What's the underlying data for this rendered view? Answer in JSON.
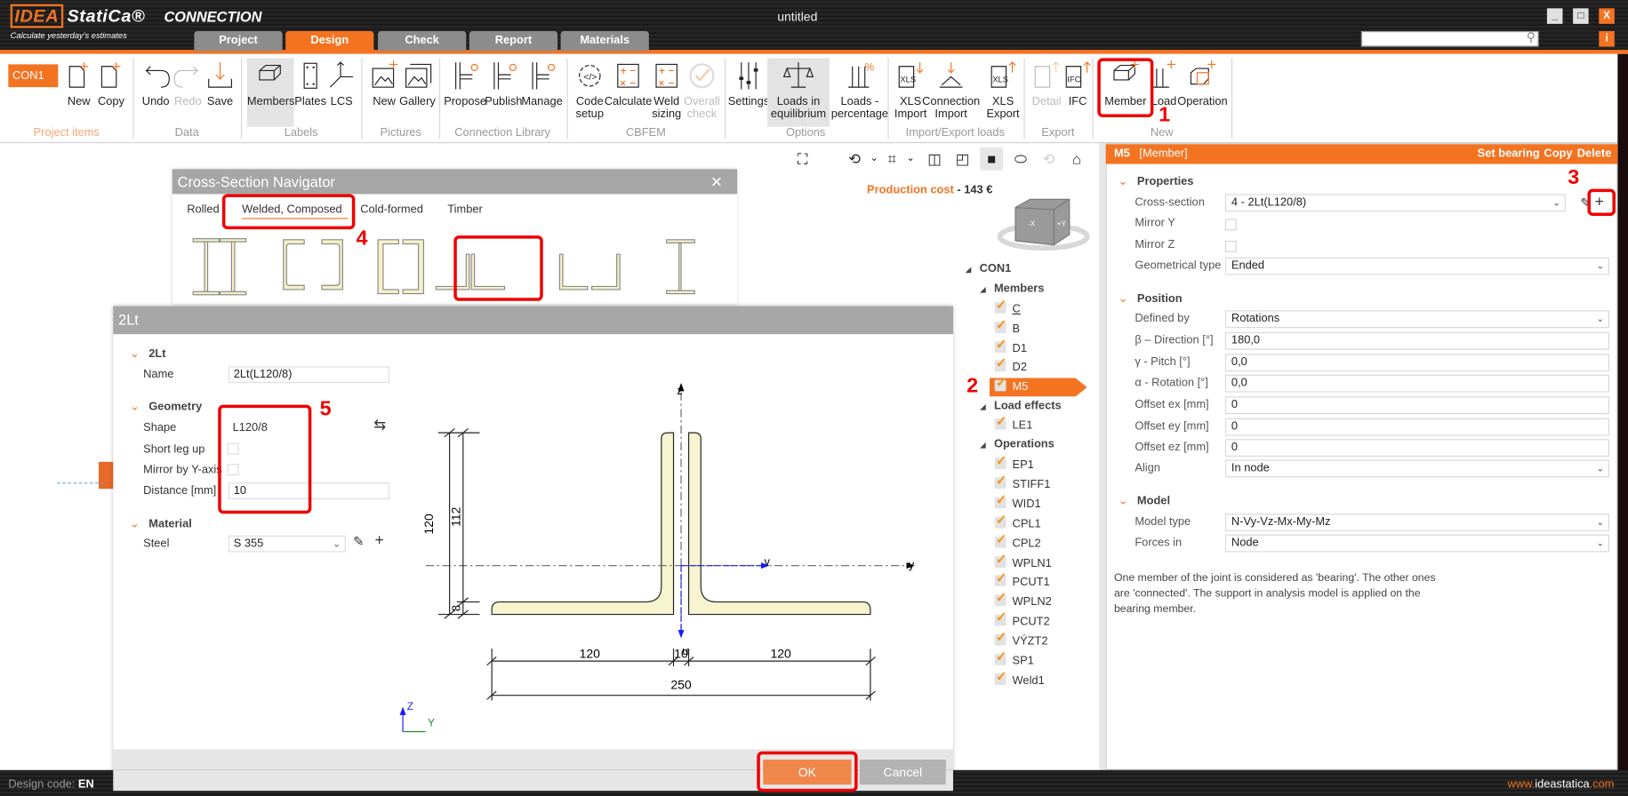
{
  "app": {
    "logo_mark": "IDEA",
    "logo_text": "StatiCa®",
    "product": "CONNECTION",
    "tagline": "Calculate yesterday's estimates",
    "title": "untitled",
    "window_buttons": [
      "_",
      "□",
      "X"
    ],
    "info": "i",
    "search_placeholder": ""
  },
  "tabs": [
    {
      "label": "Project",
      "active": false
    },
    {
      "label": "Design",
      "active": true
    },
    {
      "label": "Check",
      "active": false
    },
    {
      "label": "Report",
      "active": false
    },
    {
      "label": "Materials",
      "active": false
    }
  ],
  "ribbon": {
    "project_selector": "CON1",
    "buttons": [
      {
        "id": "new",
        "label": "New",
        "icon": "doc-plus-icon",
        "group": "Project items"
      },
      {
        "id": "copy",
        "label": "Copy",
        "icon": "doc-copy-icon",
        "group": "Project items"
      },
      {
        "id": "undo",
        "label": "Undo",
        "icon": "undo-icon",
        "group": "Data"
      },
      {
        "id": "redo",
        "label": "Redo",
        "icon": "redo-icon",
        "group": "Data",
        "disabled": true
      },
      {
        "id": "save",
        "label": "Save",
        "icon": "save-icon",
        "group": "Data"
      },
      {
        "id": "members",
        "label": "Members",
        "icon": "beam-icon",
        "group": "Labels",
        "active": true
      },
      {
        "id": "plates",
        "label": "Plates",
        "icon": "plate-icon",
        "group": "Labels"
      },
      {
        "id": "lcs",
        "label": "LCS",
        "icon": "axes-icon",
        "group": "Labels"
      },
      {
        "id": "picture-new",
        "label": "New",
        "icon": "picture-plus-icon",
        "group": "Pictures"
      },
      {
        "id": "gallery",
        "label": "Gallery",
        "icon": "gallery-icon",
        "group": "Pictures"
      },
      {
        "id": "propose",
        "label": "Propose",
        "icon": "library-search-icon",
        "group": "Connection Library"
      },
      {
        "id": "publish",
        "label": "Publish",
        "icon": "library-upload-icon",
        "group": "Connection Library"
      },
      {
        "id": "manage",
        "label": "Manage",
        "icon": "library-edit-icon",
        "group": "Connection Library"
      },
      {
        "id": "code-setup",
        "label": "Code\nsetup",
        "icon": "gear-code-icon",
        "group": "CBFEM"
      },
      {
        "id": "calculate",
        "label": "Calculate",
        "icon": "calculator-icon",
        "group": "CBFEM"
      },
      {
        "id": "weld-sizing",
        "label": "Weld\nsizing",
        "icon": "weld-calc-icon",
        "group": "CBFEM"
      },
      {
        "id": "overall-check",
        "label": "Overall\ncheck",
        "icon": "check-circle-icon",
        "group": "CBFEM",
        "disabled": true
      },
      {
        "id": "settings",
        "label": "Settings",
        "icon": "sliders-icon",
        "group": "Options"
      },
      {
        "id": "loads-equilibrium",
        "label": "Loads in\nequilibrium",
        "icon": "balance-icon",
        "group": "Options",
        "active": true
      },
      {
        "id": "loads-percentage",
        "label": "Loads -\npercentage",
        "icon": "loads-percent-icon",
        "group": "Options"
      },
      {
        "id": "xls-import",
        "label": "XLS\nImport",
        "icon": "xls-import-icon",
        "group": "Import/Export loads"
      },
      {
        "id": "connection-import",
        "label": "Connection\nImport",
        "icon": "connection-import-icon",
        "group": "Import/Export loads"
      },
      {
        "id": "xls-export",
        "label": "XLS\nExport",
        "icon": "xls-export-icon",
        "group": "Import/Export loads"
      },
      {
        "id": "detail",
        "label": "Detail",
        "icon": "beta-detail-icon",
        "group": "Export",
        "disabled": true
      },
      {
        "id": "ifc",
        "label": "IFC",
        "icon": "ifc-export-icon",
        "group": "Export"
      },
      {
        "id": "member",
        "label": "Member",
        "icon": "member-add-icon",
        "group": "New"
      },
      {
        "id": "load",
        "label": "Load",
        "icon": "load-add-icon",
        "group": "New"
      },
      {
        "id": "operation",
        "label": "Operation",
        "icon": "operation-add-icon",
        "group": "New"
      }
    ],
    "groups": [
      "Project items",
      "Data",
      "Labels",
      "Pictures",
      "Connection Library",
      "CBFEM",
      "Options",
      "Import/Export loads",
      "Export",
      "New"
    ]
  },
  "viewport": {
    "toolbar_icons": [
      "fit-view-icon",
      "rotate-icon",
      "chevron-down-icon",
      "crop-icon",
      "chevron-down-icon",
      "wireframe-icon",
      "transparent-icon",
      "solid-icon",
      "render-icon",
      "mirror-icon",
      "home-icon"
    ],
    "production_cost_label": "Production cost",
    "production_cost_sep": "-",
    "production_cost_value": "143 €",
    "navcube_labels": [
      "-X",
      "+Y"
    ]
  },
  "tree": {
    "root": "CON1",
    "members_label": "Members",
    "members": [
      "C",
      "B",
      "D1",
      "D2",
      "M5"
    ],
    "selected_member": "M5",
    "load_effects_label": "Load effects",
    "load_effects": [
      "LE1"
    ],
    "operations_label": "Operations",
    "operations": [
      "EP1",
      "STIFF1",
      "WID1",
      "CPL1",
      "CPL2",
      "WPLN1",
      "PCUT1",
      "WPLN2",
      "PCUT2",
      "VÝZT2",
      "SP1",
      "Weld1"
    ]
  },
  "properties_panel": {
    "header_name": "M5",
    "header_type": "[Member]",
    "actions": [
      "Set bearing",
      "Copy",
      "Delete"
    ],
    "sections": [
      {
        "title": "Properties",
        "rows": [
          {
            "label": "Cross-section",
            "type": "select",
            "value": "4 - 2Lt(L120/8)",
            "short": true
          },
          {
            "label": "Mirror Y",
            "type": "checkbox",
            "checked": false
          },
          {
            "label": "Mirror Z",
            "type": "checkbox",
            "checked": false
          },
          {
            "label": "Geometrical type",
            "type": "select",
            "value": "Ended"
          }
        ]
      },
      {
        "title": "Position",
        "rows": [
          {
            "label": "Defined by",
            "type": "select",
            "value": "Rotations"
          },
          {
            "label": "β – Direction [°]",
            "type": "input",
            "value": "180,0"
          },
          {
            "label": "γ - Pitch [°]",
            "type": "input",
            "value": "0,0"
          },
          {
            "label": "α - Rotation [°]",
            "type": "input",
            "value": "0,0"
          },
          {
            "label": "Offset ex [mm]",
            "type": "input",
            "value": "0"
          },
          {
            "label": "Offset ey [mm]",
            "type": "input",
            "value": "0"
          },
          {
            "label": "Offset ez [mm]",
            "type": "input",
            "value": "0"
          },
          {
            "label": "Align",
            "type": "select",
            "value": "In node"
          }
        ]
      },
      {
        "title": "Model",
        "rows": [
          {
            "label": "Model type",
            "type": "select",
            "value": "N-Vy-Vz-Mx-My-Mz"
          },
          {
            "label": "Forces in",
            "type": "select",
            "value": "Node"
          }
        ]
      }
    ],
    "note": [
      "One member of the joint is considered as 'bearing'. The other ones",
      "are 'connected'. The support in analysis model is applied on the",
      "bearing member."
    ]
  },
  "navigator": {
    "title": "Cross-Section Navigator",
    "tabs": [
      "Rolled",
      "Welded, Composed",
      "Cold-formed",
      "Timber"
    ],
    "active_tab": "Welded, Composed",
    "shapes": [
      "double-i-shape-icon",
      "double-channel-out-shape-icon",
      "double-channel-box-shape-icon",
      "double-angle-t-shape-icon",
      "double-angle-shape-icon",
      "welded-i-shape-icon"
    ],
    "selected_shape": "double-angle-t-shape-icon"
  },
  "dialog": {
    "title": "2Lt",
    "section_main": "2Lt",
    "name_label": "Name",
    "name_value": "2Lt(L120/8)",
    "section_geometry": "Geometry",
    "shape_label": "Shape",
    "shape_value": "L120/8",
    "short_leg_label": "Short leg up",
    "short_leg_checked": false,
    "mirror_label": "Mirror by Y-axis",
    "mirror_checked": false,
    "distance_label": "Distance [mm]",
    "distance_value": "10",
    "section_material": "Material",
    "steel_label": "Steel",
    "steel_value": "S 355",
    "ok": "OK",
    "cancel": "Cancel",
    "drawing": {
      "axis_z": "z",
      "axis_y": "y",
      "axis_v": "v",
      "axis_u": "u",
      "dim_height": "120",
      "dim_leg": "112",
      "dim_thickness": "8",
      "dim_left": "120",
      "dim_gap": "10",
      "dim_right": "120",
      "dim_total": "250",
      "csys_z": "Z",
      "csys_y": "Y"
    }
  },
  "status": {
    "design_code_label": "Design code:",
    "design_code_value": "EN",
    "website_prefix": "www.",
    "website_main": "ideastatica",
    "website_suffix": ".com"
  },
  "annotations": [
    "1",
    "2",
    "3",
    "4",
    "5"
  ],
  "colors": {
    "accent": "#f47321",
    "annotation": "#ee0000",
    "section_fill": "#f7f5cf"
  }
}
